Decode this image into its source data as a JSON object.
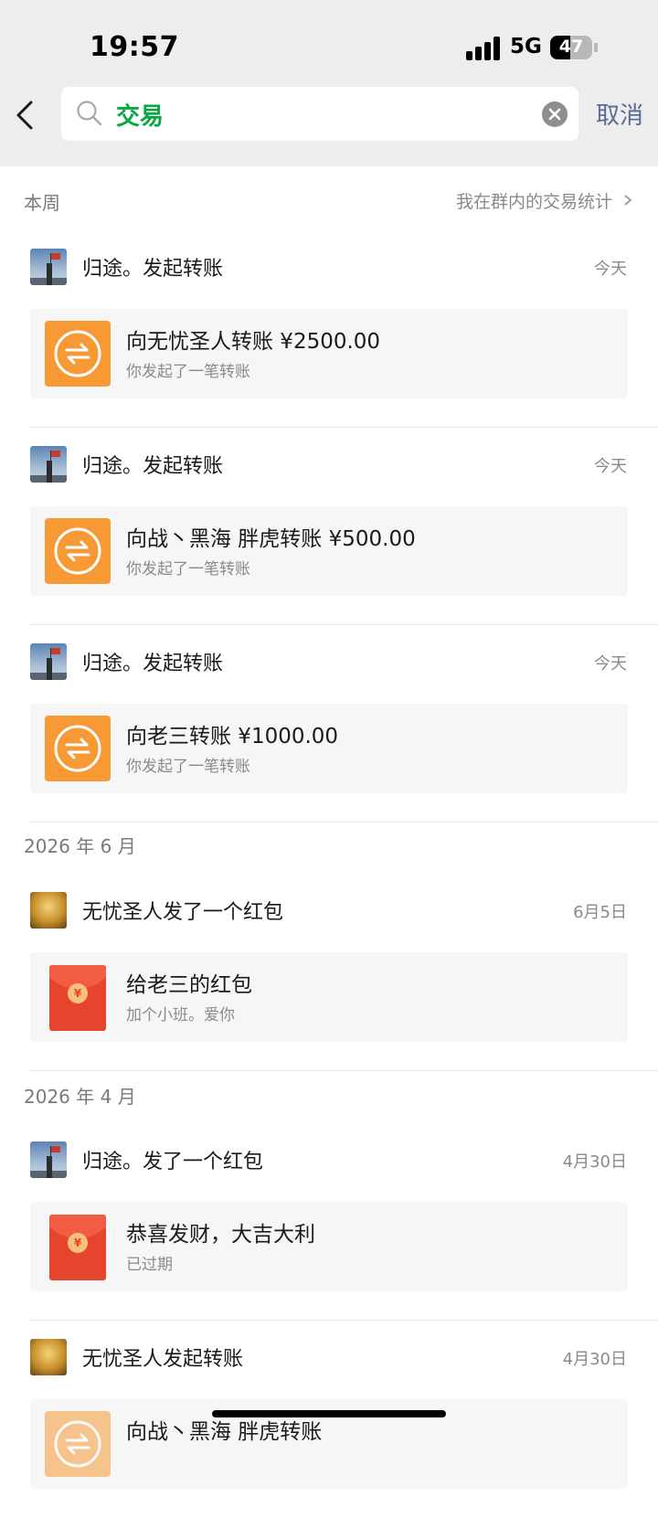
{
  "status_bar": {
    "time": "19:57",
    "network": "5G",
    "battery": "47",
    "battery_level": 0.47
  },
  "search": {
    "query": "交易",
    "cancel_label": "取消"
  },
  "sections": [
    {
      "title": "本周",
      "link": "我在群内的交易统计",
      "items": [
        {
          "avatar": "flag-on-mountain",
          "title": "归途。发起转账",
          "date": "今天",
          "card_icon": "transfer",
          "card_title": "向无忧圣人转账 ¥2500.00",
          "card_sub": "你发起了一笔转账"
        },
        {
          "avatar": "flag-on-mountain",
          "title": "归途。发起转账",
          "date": "今天",
          "card_icon": "transfer",
          "card_title": "向战丶黑海  胖虎转账 ¥500.00",
          "card_sub": "你发起了一笔转账"
        },
        {
          "avatar": "flag-on-mountain",
          "title": "归途。发起转账",
          "date": "今天",
          "card_icon": "transfer",
          "card_title": "向老三转账 ¥1000.00",
          "card_sub": "你发起了一笔转账"
        }
      ]
    },
    {
      "title": "2026 年 6 月",
      "items": [
        {
          "avatar": "golden-dragon",
          "title": "无忧圣人发了一个红包",
          "date": "6月5日",
          "card_icon": "red-packet",
          "card_title": "给老三的红包",
          "card_sub": "加个小班。爱你"
        }
      ]
    },
    {
      "title": "2026 年 4 月",
      "items": [
        {
          "avatar": "flag-on-mountain",
          "title": "归途。发了一个红包",
          "date": "4月30日",
          "card_icon": "red-packet",
          "card_title": "恭喜发财，大吉大利",
          "card_sub": "已过期"
        },
        {
          "avatar": "golden-dragon",
          "title": "无忧圣人发起转账",
          "date": "4月30日",
          "card_icon": "transfer",
          "card_title": "向战丶黑海  胖虎转账"
        }
      ]
    }
  ]
}
